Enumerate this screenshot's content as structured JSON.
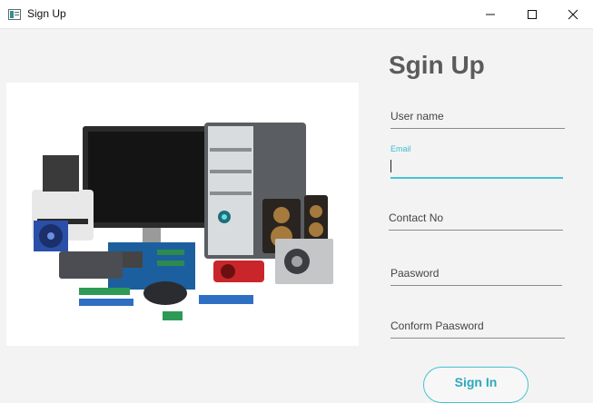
{
  "window": {
    "title": "Sign Up",
    "controls": [
      "minimize-icon",
      "maximize-icon",
      "close-icon"
    ]
  },
  "illustration": {
    "subject": "computer hardware collection (monitor, tower, printer, speakers, power supply, cards, mouse)",
    "icon": "hardware-photo"
  },
  "form": {
    "heading": "Sgin Up",
    "user_name_label": "User name",
    "email_label": "Email",
    "email_value": "",
    "contact_label": "Contact No",
    "password_label": "Paasword",
    "confirm_label": "Conform Paasword",
    "submit_label": "Sign In"
  },
  "colors": {
    "accent": "#44c3d3",
    "heading": "#5b5b5b",
    "background": "#f3f3f3"
  }
}
